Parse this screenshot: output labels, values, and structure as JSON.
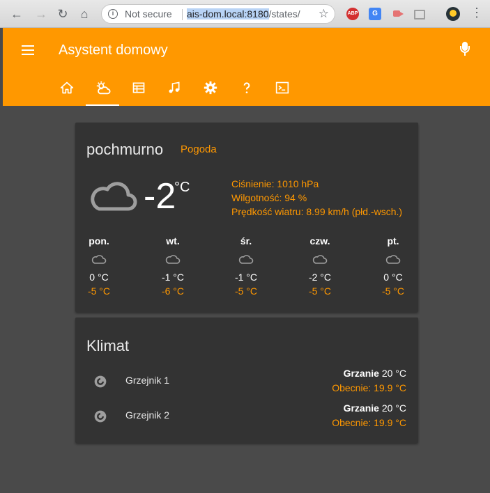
{
  "browser": {
    "security_label": "Not secure",
    "url_host": "ais-dom.local:8180",
    "url_path": "/states/",
    "extensions": [
      "ABP",
      "G"
    ]
  },
  "app": {
    "title": "Asystent domowy",
    "tabs": [
      {
        "icon": "home-icon",
        "active": false
      },
      {
        "icon": "weather-partly-cloudy-icon",
        "active": true
      },
      {
        "icon": "calendar-table-icon",
        "active": false
      },
      {
        "icon": "music-note-icon",
        "active": false
      },
      {
        "icon": "gear-icon",
        "active": false
      },
      {
        "icon": "help-icon",
        "active": false
      },
      {
        "icon": "console-icon",
        "active": false
      }
    ],
    "accent_color": "#ff9800"
  },
  "weather": {
    "condition": "pochmurno",
    "name": "Pogoda",
    "temperature": "-2",
    "unit": "°C",
    "attributes": [
      "Ciśnienie: 1010 hPa",
      "Wilgotność: 94 %",
      "Prędkość wiatru: 8.99 km/h (płd.-wsch.)"
    ],
    "forecast": [
      {
        "day": "pon.",
        "high": "0 °C",
        "low": "-5 °C"
      },
      {
        "day": "wt.",
        "high": "-1 °C",
        "low": "-6 °C"
      },
      {
        "day": "śr.",
        "high": "-1 °C",
        "low": "-5 °C"
      },
      {
        "day": "czw.",
        "high": "-2 °C",
        "low": "-5 °C"
      },
      {
        "day": "pt.",
        "high": "0 °C",
        "low": "-5 °C"
      }
    ]
  },
  "climate": {
    "title": "Klimat",
    "items": [
      {
        "name": "Grzejnik 1",
        "mode": "Grzanie",
        "target": "20 °C",
        "current": "Obecnie: 19.9 °C"
      },
      {
        "name": "Grzejnik 2",
        "mode": "Grzanie",
        "target": "20 °C",
        "current": "Obecnie: 19.9 °C"
      }
    ]
  }
}
